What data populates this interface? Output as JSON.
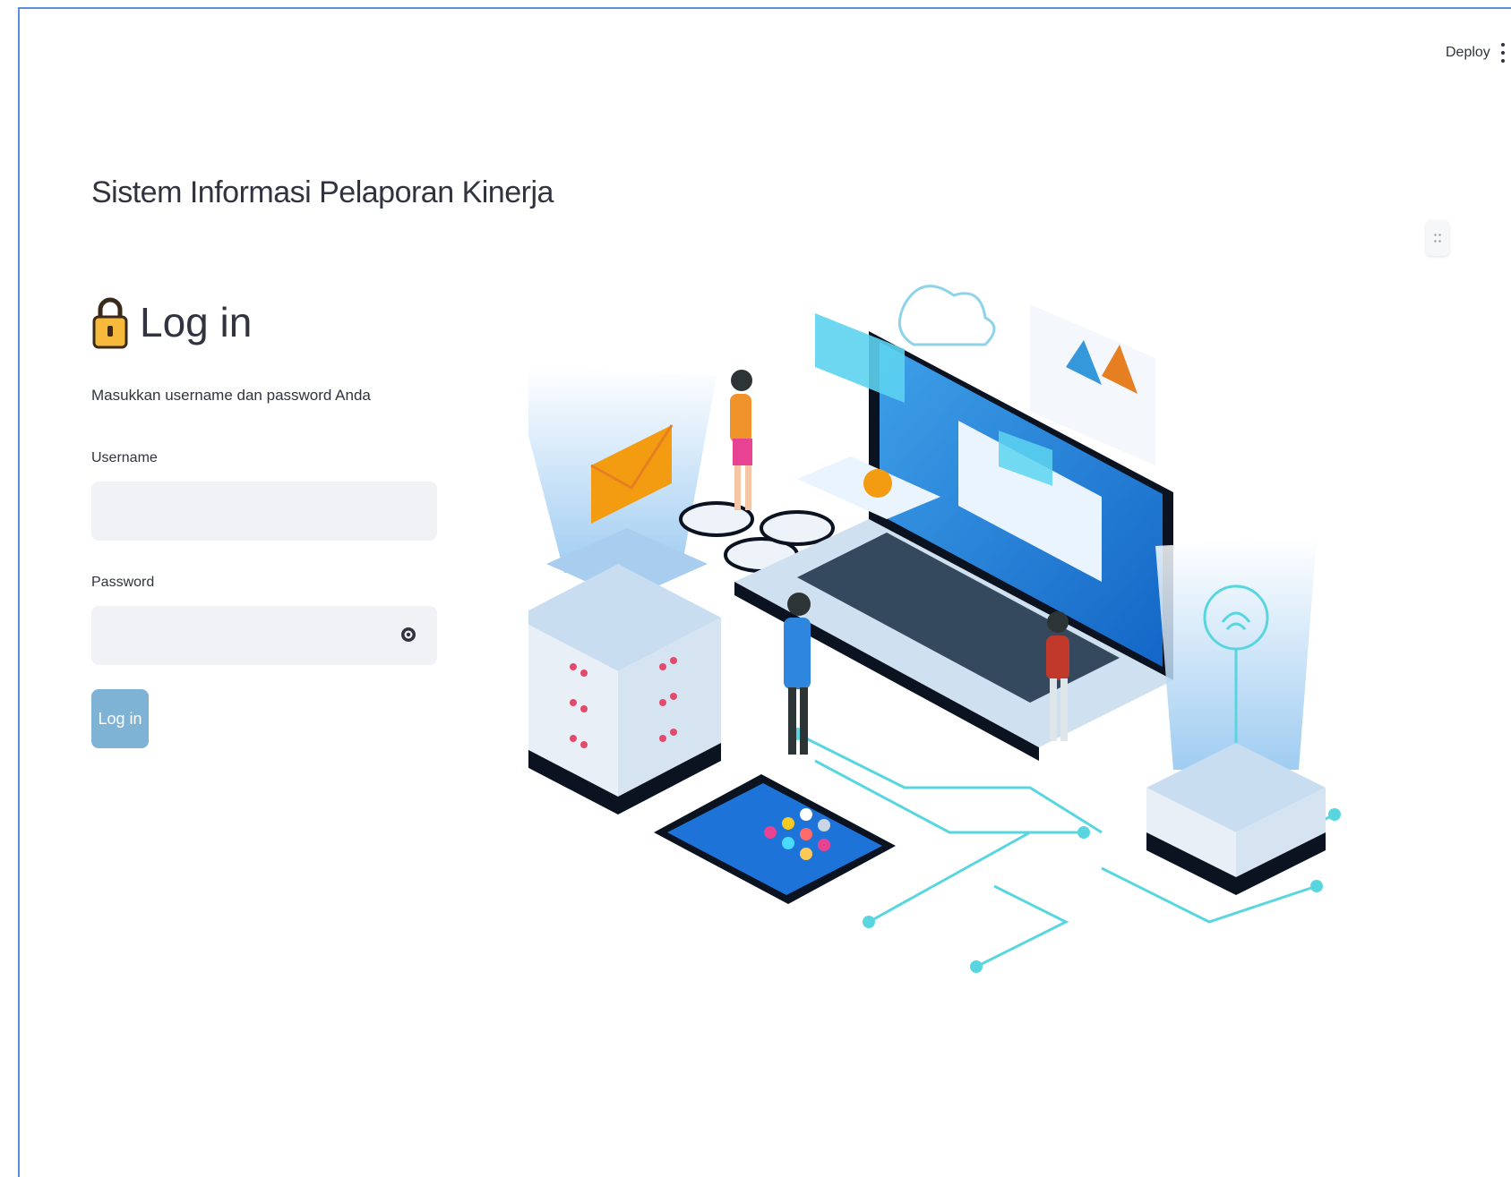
{
  "header": {
    "deploy_label": "Deploy",
    "menu_icon": "kebab-menu-icon"
  },
  "app": {
    "title": "Sistem Informasi Pelaporan Kinerja"
  },
  "login": {
    "icon": "padlock-icon",
    "heading": "Log in",
    "subtitle": "Masukkan username dan password Anda",
    "username_label": "Username",
    "username_value": "",
    "password_label": "Password",
    "password_value": "",
    "password_toggle_icon": "eye-icon",
    "submit_label": "Log in"
  },
  "illustration": {
    "icon": "cloud-computing-illustration"
  },
  "colors": {
    "accent": "#7fb3d5",
    "input_bg": "#f0f2f6",
    "text": "#31333f",
    "frame": "#5b8fd6"
  }
}
